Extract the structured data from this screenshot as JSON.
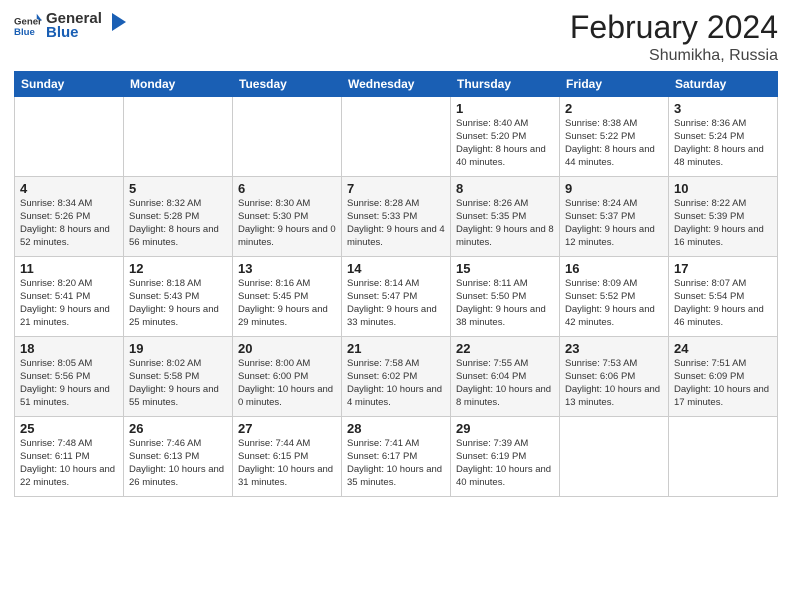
{
  "header": {
    "logo": {
      "general": "General",
      "blue": "Blue"
    },
    "title": "February 2024",
    "subtitle": "Shumikha, Russia"
  },
  "weekdays": [
    "Sunday",
    "Monday",
    "Tuesday",
    "Wednesday",
    "Thursday",
    "Friday",
    "Saturday"
  ],
  "weeks": [
    [
      {
        "day": "",
        "info": ""
      },
      {
        "day": "",
        "info": ""
      },
      {
        "day": "",
        "info": ""
      },
      {
        "day": "",
        "info": ""
      },
      {
        "day": "1",
        "info": "Sunrise: 8:40 AM\nSunset: 5:20 PM\nDaylight: 8 hours\nand 40 minutes."
      },
      {
        "day": "2",
        "info": "Sunrise: 8:38 AM\nSunset: 5:22 PM\nDaylight: 8 hours\nand 44 minutes."
      },
      {
        "day": "3",
        "info": "Sunrise: 8:36 AM\nSunset: 5:24 PM\nDaylight: 8 hours\nand 48 minutes."
      }
    ],
    [
      {
        "day": "4",
        "info": "Sunrise: 8:34 AM\nSunset: 5:26 PM\nDaylight: 8 hours\nand 52 minutes."
      },
      {
        "day": "5",
        "info": "Sunrise: 8:32 AM\nSunset: 5:28 PM\nDaylight: 8 hours\nand 56 minutes."
      },
      {
        "day": "6",
        "info": "Sunrise: 8:30 AM\nSunset: 5:30 PM\nDaylight: 9 hours\nand 0 minutes."
      },
      {
        "day": "7",
        "info": "Sunrise: 8:28 AM\nSunset: 5:33 PM\nDaylight: 9 hours\nand 4 minutes."
      },
      {
        "day": "8",
        "info": "Sunrise: 8:26 AM\nSunset: 5:35 PM\nDaylight: 9 hours\nand 8 minutes."
      },
      {
        "day": "9",
        "info": "Sunrise: 8:24 AM\nSunset: 5:37 PM\nDaylight: 9 hours\nand 12 minutes."
      },
      {
        "day": "10",
        "info": "Sunrise: 8:22 AM\nSunset: 5:39 PM\nDaylight: 9 hours\nand 16 minutes."
      }
    ],
    [
      {
        "day": "11",
        "info": "Sunrise: 8:20 AM\nSunset: 5:41 PM\nDaylight: 9 hours\nand 21 minutes."
      },
      {
        "day": "12",
        "info": "Sunrise: 8:18 AM\nSunset: 5:43 PM\nDaylight: 9 hours\nand 25 minutes."
      },
      {
        "day": "13",
        "info": "Sunrise: 8:16 AM\nSunset: 5:45 PM\nDaylight: 9 hours\nand 29 minutes."
      },
      {
        "day": "14",
        "info": "Sunrise: 8:14 AM\nSunset: 5:47 PM\nDaylight: 9 hours\nand 33 minutes."
      },
      {
        "day": "15",
        "info": "Sunrise: 8:11 AM\nSunset: 5:50 PM\nDaylight: 9 hours\nand 38 minutes."
      },
      {
        "day": "16",
        "info": "Sunrise: 8:09 AM\nSunset: 5:52 PM\nDaylight: 9 hours\nand 42 minutes."
      },
      {
        "day": "17",
        "info": "Sunrise: 8:07 AM\nSunset: 5:54 PM\nDaylight: 9 hours\nand 46 minutes."
      }
    ],
    [
      {
        "day": "18",
        "info": "Sunrise: 8:05 AM\nSunset: 5:56 PM\nDaylight: 9 hours\nand 51 minutes."
      },
      {
        "day": "19",
        "info": "Sunrise: 8:02 AM\nSunset: 5:58 PM\nDaylight: 9 hours\nand 55 minutes."
      },
      {
        "day": "20",
        "info": "Sunrise: 8:00 AM\nSunset: 6:00 PM\nDaylight: 10 hours\nand 0 minutes."
      },
      {
        "day": "21",
        "info": "Sunrise: 7:58 AM\nSunset: 6:02 PM\nDaylight: 10 hours\nand 4 minutes."
      },
      {
        "day": "22",
        "info": "Sunrise: 7:55 AM\nSunset: 6:04 PM\nDaylight: 10 hours\nand 8 minutes."
      },
      {
        "day": "23",
        "info": "Sunrise: 7:53 AM\nSunset: 6:06 PM\nDaylight: 10 hours\nand 13 minutes."
      },
      {
        "day": "24",
        "info": "Sunrise: 7:51 AM\nSunset: 6:09 PM\nDaylight: 10 hours\nand 17 minutes."
      }
    ],
    [
      {
        "day": "25",
        "info": "Sunrise: 7:48 AM\nSunset: 6:11 PM\nDaylight: 10 hours\nand 22 minutes."
      },
      {
        "day": "26",
        "info": "Sunrise: 7:46 AM\nSunset: 6:13 PM\nDaylight: 10 hours\nand 26 minutes."
      },
      {
        "day": "27",
        "info": "Sunrise: 7:44 AM\nSunset: 6:15 PM\nDaylight: 10 hours\nand 31 minutes."
      },
      {
        "day": "28",
        "info": "Sunrise: 7:41 AM\nSunset: 6:17 PM\nDaylight: 10 hours\nand 35 minutes."
      },
      {
        "day": "29",
        "info": "Sunrise: 7:39 AM\nSunset: 6:19 PM\nDaylight: 10 hours\nand 40 minutes."
      },
      {
        "day": "",
        "info": ""
      },
      {
        "day": "",
        "info": ""
      }
    ]
  ]
}
